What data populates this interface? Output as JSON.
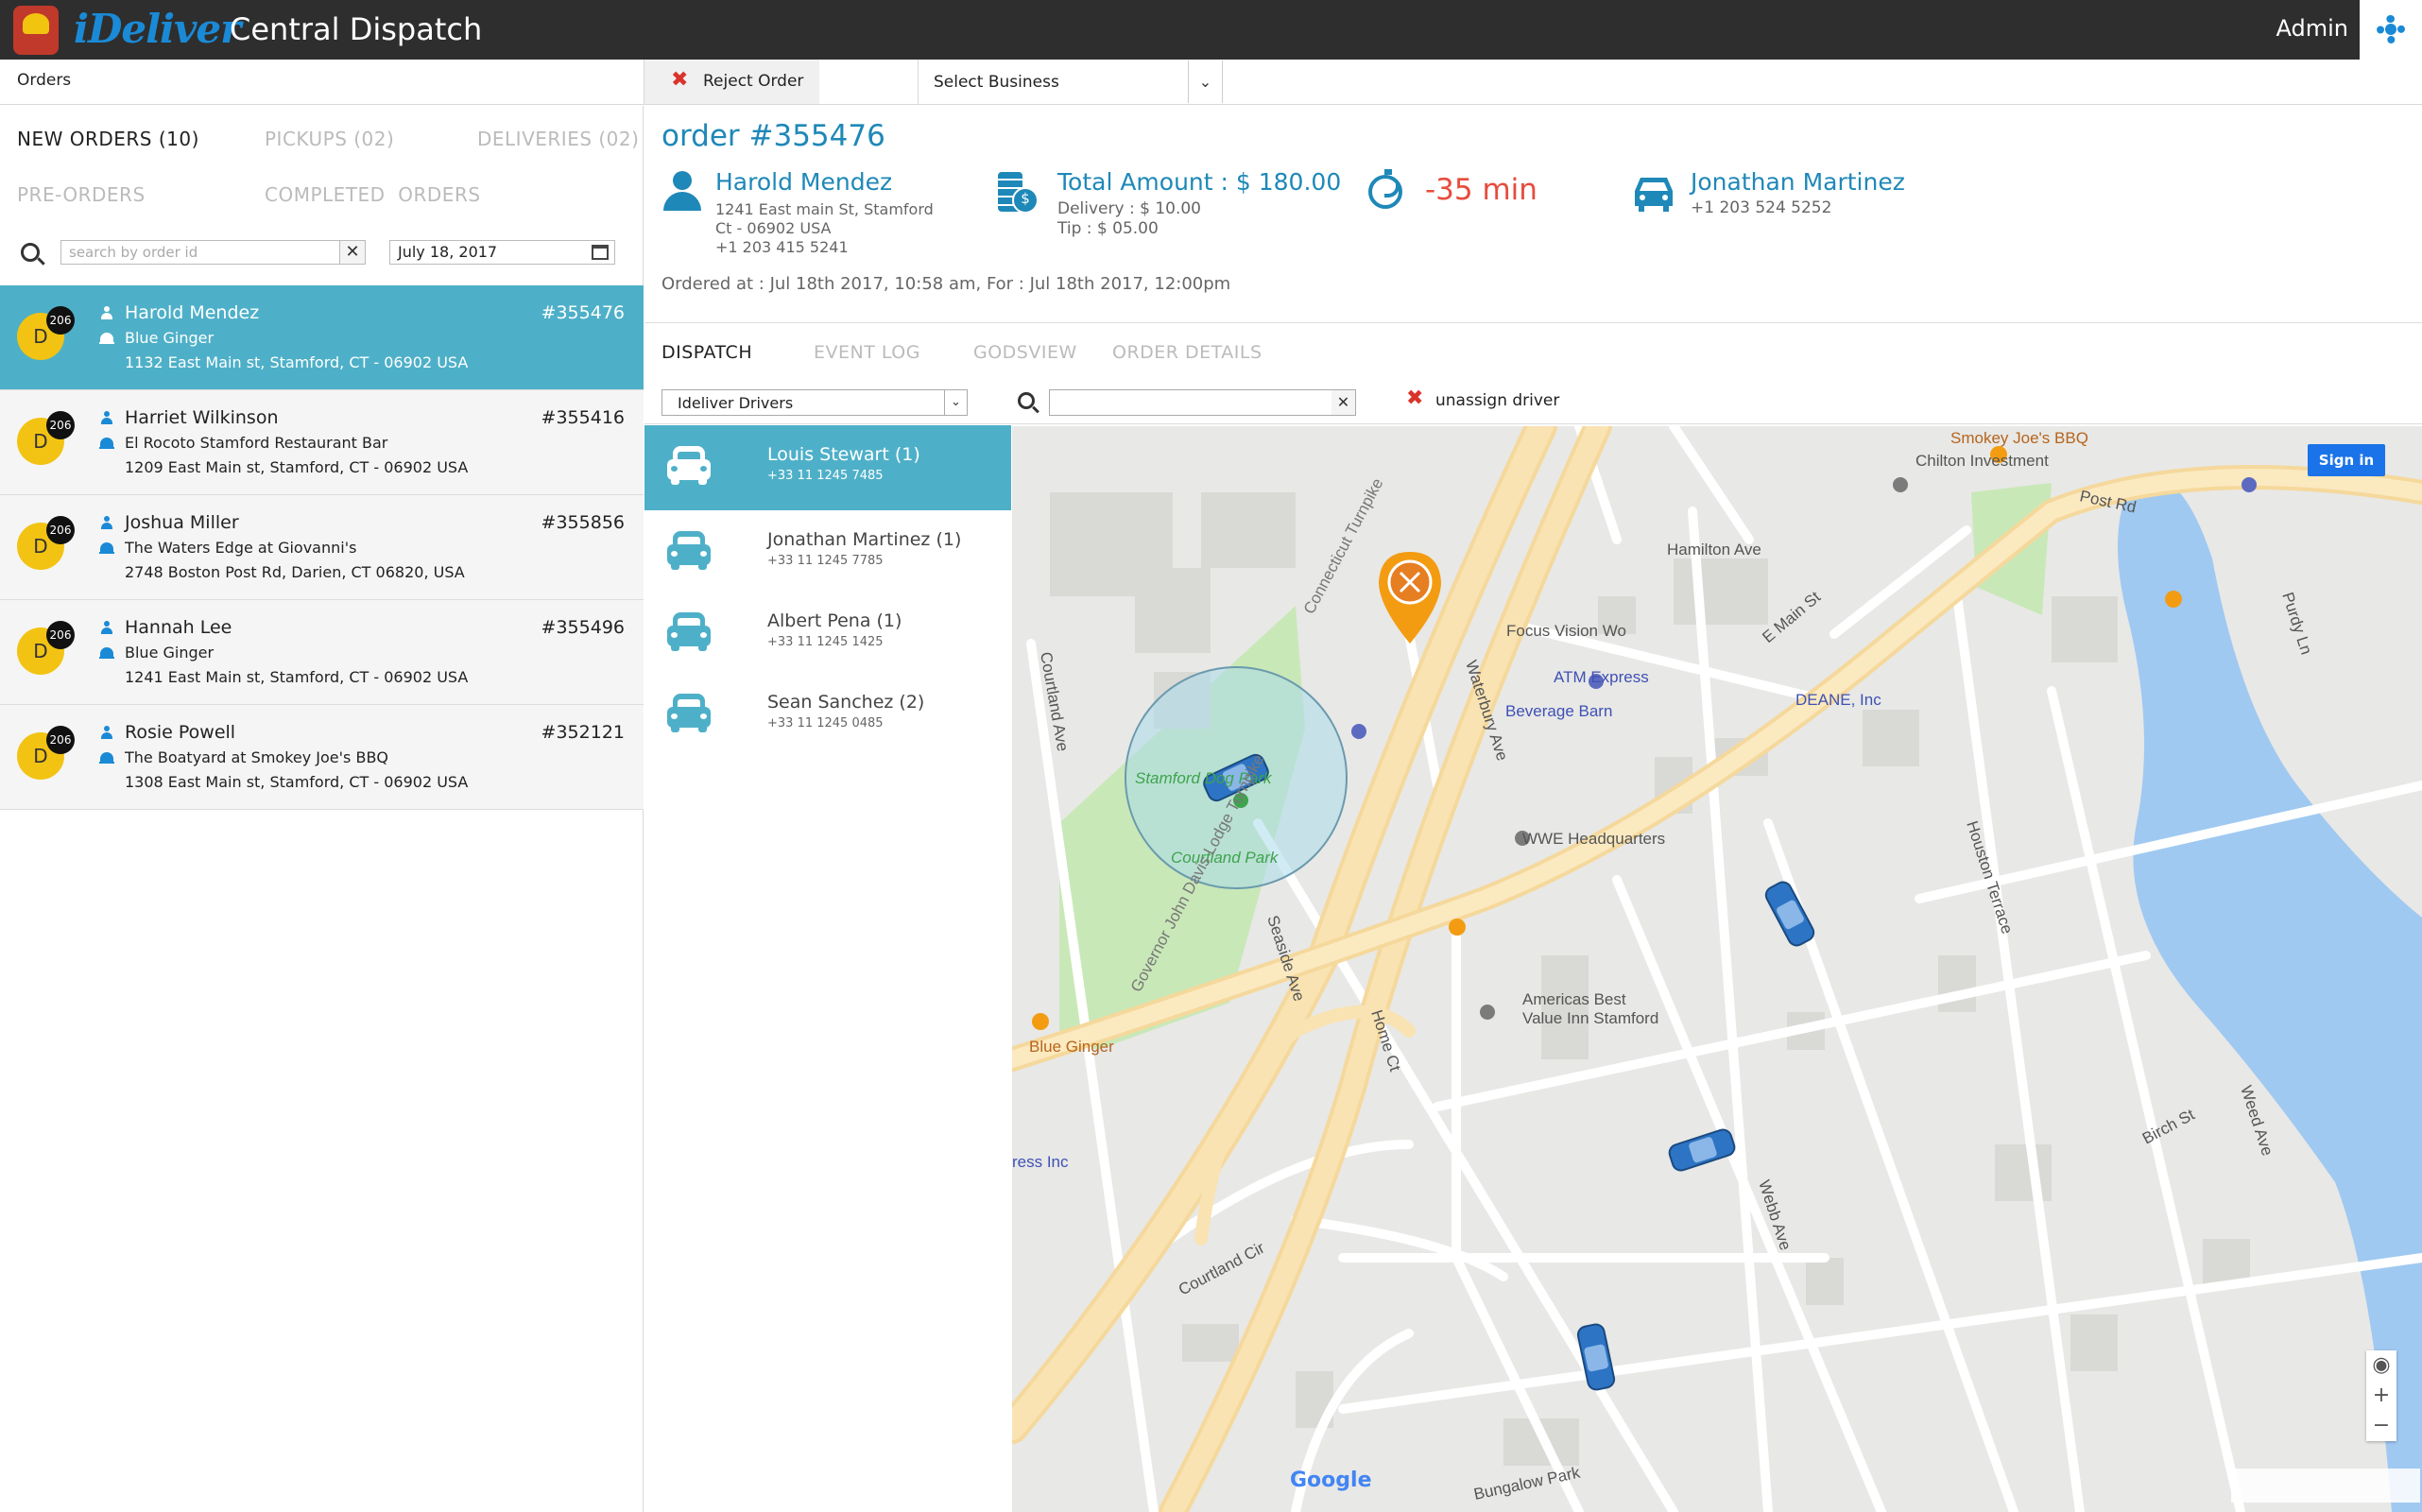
{
  "header": {
    "brand": "iDeliver",
    "title": "Central Dispatch",
    "user": "Admin",
    "settings_icon": "gear-icon"
  },
  "toolbar": {
    "orders_label": "Orders",
    "reject_label": "Reject Order",
    "business_select": "Select Business"
  },
  "order_tabs": {
    "new_orders": "NEW ORDERS (10)",
    "pickups": "PICKUPS (02)",
    "deliveries": "DELIVERIES (02)",
    "pre_orders": "PRE-ORDERS",
    "completed": "COMPLETED  ORDERS"
  },
  "filters": {
    "search_placeholder": "search by order id",
    "date": "July 18, 2017"
  },
  "orders": [
    {
      "badge": "D",
      "count": "206",
      "name": "Harold Mendez",
      "business": "Blue Ginger",
      "address": "1132 East Main st, Stamford, CT - 06902 USA",
      "id": "#355476"
    },
    {
      "badge": "D",
      "count": "206",
      "name": "Harriet Wilkinson",
      "business": "El Rocoto Stamford Restaurant Bar",
      "address": "1209 East Main st, Stamford, CT - 06902 USA",
      "id": "#355416"
    },
    {
      "badge": "D",
      "count": "206",
      "name": "Joshua Miller",
      "business": "The Waters Edge at Giovanni's",
      "address": "2748 Boston Post Rd, Darien, CT 06820, USA",
      "id": "#355856"
    },
    {
      "badge": "D",
      "count": "206",
      "name": "Hannah Lee",
      "business": "Blue Ginger",
      "address": "1241 East Main st, Stamford, CT - 06902 USA",
      "id": "#355496"
    },
    {
      "badge": "D",
      "count": "206",
      "name": "Rosie Powell",
      "business": "The Boatyard at Smokey Joe's BBQ",
      "address": "1308 East Main st, Stamford, CT - 06902 USA",
      "id": "#352121"
    }
  ],
  "order_detail": {
    "number": "order #355476",
    "customer_name": "Harold Mendez",
    "customer_addr1": "1241 East main St, Stamford",
    "customer_addr2": "Ct - 06902 USA",
    "customer_phone": "+1 203 415 5241",
    "total": "Total Amount : $ 180.00",
    "delivery_fee": "Delivery : $ 10.00",
    "tip": "Tip : $ 05.00",
    "eta": "-35 min",
    "driver_name": "Jonathan Martinez",
    "driver_phone": "+1 203 524 5252",
    "ordered_at": "Ordered at : Jul 18th 2017, 10:58 am, For : Jul 18th 2017, 12:00pm"
  },
  "dispatch_tabs": {
    "dispatch": "DISPATCH",
    "event_log": "EVENT LOG",
    "godsview": "GODSVIEW",
    "order_details": "ORDER DETAILS"
  },
  "dispatch": {
    "driver_group": "Ideliver Drivers",
    "unassign_label": "unassign driver"
  },
  "drivers": [
    {
      "name": "Louis Stewart (1)",
      "phone": "+33 11 1245 7485"
    },
    {
      "name": "Jonathan Martinez (1)",
      "phone": "+33 11 1245 7785"
    },
    {
      "name": "Albert Pena (1)",
      "phone": "+33 11 1245 1425"
    },
    {
      "name": "Sean Sanchez (2)",
      "phone": "+33 11 1245 0485"
    }
  ],
  "map": {
    "signin_label": "Sign in",
    "google_label": "Google",
    "zoom_in": "+",
    "zoom_out": "−",
    "labels": {
      "smokey": "Smokey Joe's BBQ",
      "chilton": "Chilton Investment",
      "hamilton": "Hamilton Ave",
      "focus": "Focus Vision Wo",
      "atm": "ATM Express",
      "deane": "DEANE, Inc",
      "beverage": "Beverage Barn",
      "emain": "E Main St",
      "postrd": "Post Rd",
      "dogpark": "Stamford Dog Park",
      "courtland_park": "Courtland Park",
      "courtland_ave": "Courtland Ave",
      "wwe": "WWE Headquarters",
      "americas_best": "Americas Best",
      "value_inn": "Value Inn Stamford",
      "blue_ginger": "Blue Ginger",
      "connecticut": "Connecticut Turnpike",
      "gov_john": "Governor John Davis Lodge Turnpike",
      "houston": "Houston Terrace",
      "waterbury": "Waterbury Ave",
      "webb": "Webb Ave",
      "seaside": "Seaside Ave",
      "home_ct": "Home Ct",
      "birch": "Birch St",
      "weed": "Weed Ave",
      "purdy": "Purdy Ln",
      "courtland_cir": "Courtland Cir",
      "bungalow": "Bungalow Park",
      "ress": "ress Inc"
    }
  }
}
